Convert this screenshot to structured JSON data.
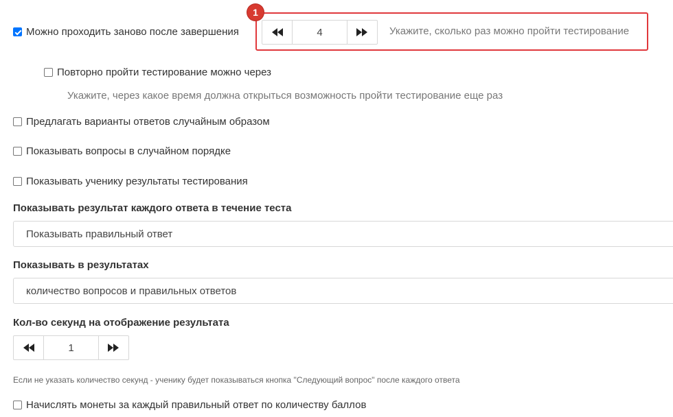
{
  "retake": {
    "checkbox_label": "Можно проходить заново после завершения",
    "checked": true,
    "count_value": "4",
    "count_hint": "Укажите, сколько раз можно пройти тестирование",
    "annotation_badge": "1"
  },
  "retake_after": {
    "checkbox_label": "Повторно пройти тестирование можно через",
    "checked": false,
    "hint": "Укажите, через какое время должна открыться возможность пройти тестирование еще раз"
  },
  "options": {
    "random_answers": "Предлагать варианты ответов случайным образом",
    "random_questions": "Показывать вопросы в случайном порядке",
    "show_results_to_student": "Показывать ученику результаты тестирования"
  },
  "answer_result": {
    "label": "Показывать результат каждого ответа в течение теста",
    "selected": "Показывать правильный ответ"
  },
  "show_in_results": {
    "label": "Показывать в результатах",
    "selected": "количество вопросов и правильных ответов"
  },
  "result_seconds": {
    "label": "Кол-во секунд на отображение результата",
    "value": "1",
    "hint": "Если не указать количество секунд - ученику будет показываться кнопка \"Следующий вопрос\" после каждого ответа"
  },
  "coins": {
    "checkbox_label": "Начислять монеты за каждый правильный ответ по количеству баллов",
    "checked": false
  },
  "colors": {
    "accent": "#0075ff",
    "highlight": "#e0373b"
  }
}
